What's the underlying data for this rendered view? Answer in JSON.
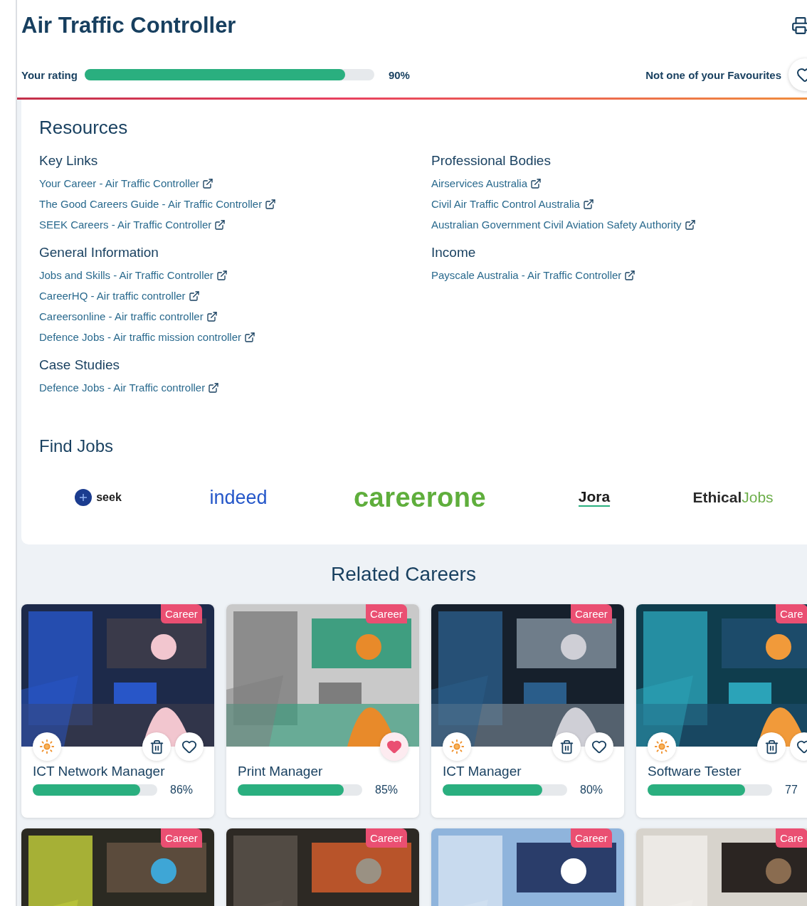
{
  "title": "Air Traffic Controller",
  "rating": {
    "label": "Your rating",
    "level": 0.9,
    "value": "90%"
  },
  "favourite": {
    "label": "Not one of your Favourites",
    "on": false
  },
  "resources": {
    "heading": "Resources",
    "columns": [
      [
        {
          "heading": "Key Links",
          "links": [
            "Your Career - Air Traffic Controller",
            "The Good Careers Guide - Air Traffic Controller",
            "SEEK Careers - Air Traffic Controller"
          ]
        },
        {
          "heading": "General Information",
          "links": [
            "Jobs and Skills - Air Traffic Controller",
            "CareerHQ - Air traffic controller",
            "Careersonline - Air traffic controller",
            "Defence Jobs - Air traffic mission controller"
          ]
        },
        {
          "heading": "Case Studies",
          "links": [
            "Defence Jobs - Air Traffic controller"
          ]
        }
      ],
      [
        {
          "heading": "Professional Bodies",
          "links": [
            "Airservices Australia",
            "Civil Air Traffic Control Australia",
            "Australian Government Civil Aviation Safety Authority"
          ]
        },
        {
          "heading": "Income",
          "links": [
            "Payscale Australia - Air Traffic Controller"
          ]
        }
      ]
    ]
  },
  "find_jobs": {
    "heading": "Find Jobs",
    "logos": [
      {
        "kind": "seek",
        "text": "seek"
      },
      {
        "kind": "indeed",
        "text": "indeed"
      },
      {
        "kind": "careerone",
        "text": "careerone"
      },
      {
        "kind": "jora",
        "text": "Jora"
      },
      {
        "kind": "ethicaljobs",
        "text": "Ethical",
        "text2": "Jobs"
      }
    ]
  },
  "related": {
    "heading": "Related Careers",
    "cards": [
      {
        "badge": "Career",
        "title": "ICT Network Manager",
        "value": "86%",
        "level": 0.86,
        "sun": true,
        "deletable": true,
        "favourite": false
      },
      {
        "badge": "Career",
        "title": "Print Manager",
        "value": "85%",
        "level": 0.85,
        "sun": false,
        "deletable": false,
        "favourite": true
      },
      {
        "badge": "Career",
        "title": "ICT Manager",
        "value": "80%",
        "level": 0.8,
        "sun": true,
        "deletable": true,
        "favourite": false
      },
      {
        "title": "Software Tester",
        "value": "77",
        "level": 0.78,
        "sun": true,
        "deletable": true,
        "favourite": false,
        "badge": "Care"
      },
      {
        "badge": "Career"
      },
      {
        "badge": "Career"
      },
      {
        "badge": "Career"
      },
      {
        "badge": "Care"
      }
    ]
  }
}
